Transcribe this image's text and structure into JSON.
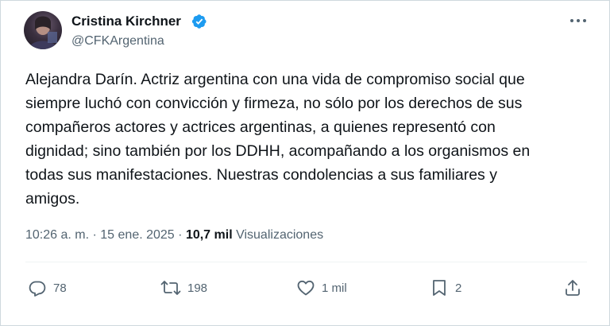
{
  "author": {
    "name": "Cristina Kirchner",
    "handle": "@CFKArgentina",
    "verified": true
  },
  "tweet": {
    "text": "Alejandra Darín. Actriz argentina con una vida de compromiso social que\nsiempre luchó con convicción y firmeza, no sólo por los derechos de sus\ncompañeros actores y actrices argentinas, a quienes representó con\ndignidad; sino también por los DDHH, acompañando a los organismos en\ntodas sus manifestaciones. Nuestras condolencias a sus familiares y\namigos.",
    "time": "10:26 a. m.",
    "separator": "·",
    "date": "15 ene. 2025",
    "views_count": "10,7 mil",
    "views_label": "Visualizaciones"
  },
  "actions": {
    "replies": "78",
    "retweets": "198",
    "likes": "1 mil",
    "bookmarks": "2"
  },
  "icons": {
    "more": "more-horizontal-icon",
    "verified": "verified-badge-icon",
    "reply": "reply-icon",
    "retweet": "retweet-icon",
    "like": "heart-icon",
    "bookmark": "bookmark-icon",
    "share": "share-icon"
  },
  "colors": {
    "text": "#0f1419",
    "secondary": "#536471",
    "verified": "#1d9bf0",
    "border": "#cfd9de"
  }
}
